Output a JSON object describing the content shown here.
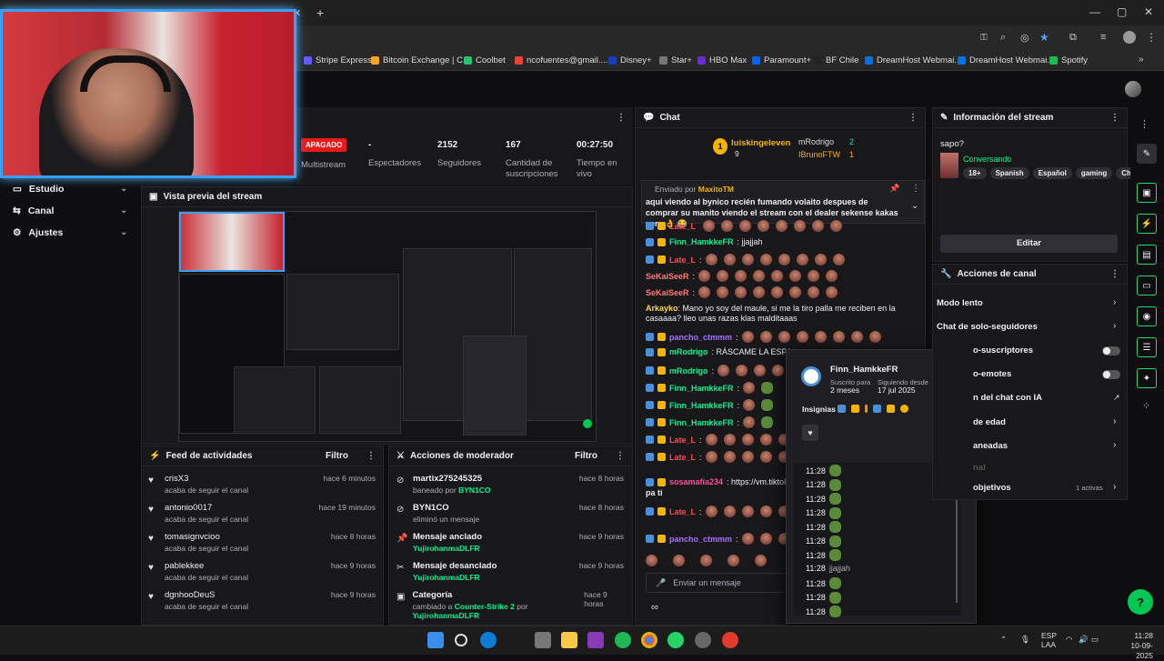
{
  "bookmarks": [
    {
      "label": "Stripe Express",
      "color": "#635bff"
    },
    {
      "label": "Bitcoin Exchange | C...",
      "color": "#f5a623"
    },
    {
      "label": "Coolbet",
      "color": "#27c26c"
    },
    {
      "label": "ncofuentes@gmail....",
      "color": "#ea4335"
    },
    {
      "label": "Disney+",
      "color": "#113ccf"
    },
    {
      "label": "Star+",
      "color": "#777"
    },
    {
      "label": "HBO Max",
      "color": "#6b2bd9"
    },
    {
      "label": "Paramount+",
      "color": "#0064ff"
    },
    {
      "label": "BF Chile",
      "color": "#222"
    },
    {
      "label": "DreamHost Webmai...",
      "color": "#0073ec"
    },
    {
      "label": "DreamHost Webmai...",
      "color": "#0073ec"
    },
    {
      "label": "Spotify",
      "color": "#1db954"
    }
  ],
  "nav": {
    "estudio": "Estudio",
    "canal": "Canal",
    "ajustes": "Ajustes"
  },
  "stats": {
    "status": "APAGADO",
    "multistream": "Multistream",
    "viewers_val": "-",
    "viewers_label": "Espectadores",
    "followers_val": "2152",
    "followers_label": "Seguidores",
    "subs_val": "167",
    "subs_label": "Cantidad de suscripciones",
    "time_val": "00:27:50",
    "time_label": "Tiempo en vivo"
  },
  "preview": {
    "title": "Vista previa del stream"
  },
  "feed": {
    "title": "Feed de actividades",
    "filter": "Filtro",
    "items": [
      {
        "user": "crisX3",
        "action": "acaba de seguir el canal",
        "time": "hace 6 minutos"
      },
      {
        "user": "antonio0017",
        "action": "acaba de seguir el canal",
        "time": "hace 19 minutos"
      },
      {
        "user": "tomasignvcioo",
        "action": "acaba de seguir el canal",
        "time": "hace 8 horas"
      },
      {
        "user": "pablekkee",
        "action": "acaba de seguir el canal",
        "time": "hace 9 horas"
      },
      {
        "user": "dgnhooDeuS",
        "action": "acaba de seguir el canal",
        "time": "hace 9 horas"
      }
    ]
  },
  "mod": {
    "title": "Acciones de moderador",
    "filter": "Filtro",
    "items": [
      {
        "title": "martix275245325",
        "pre": "baneado por ",
        "who": "BYN1CO",
        "mid": "",
        "who2": "",
        "time": "hace 8 horas"
      },
      {
        "title": "BYN1CO",
        "pre": "eliminó un mensaje",
        "who": "",
        "mid": "",
        "who2": "",
        "time": "hace 8 horas"
      },
      {
        "title": "Mensaje anclado",
        "pre": "",
        "who": "YujirohanmaDLFR",
        "mid": "",
        "who2": "",
        "time": "hace 9 horas"
      },
      {
        "title": "Mensaje desanclado",
        "pre": "",
        "who": "YujirohanmaDLFR",
        "mid": "",
        "who2": "",
        "time": "hace 9 horas"
      },
      {
        "title": "Categoría",
        "pre": "cambiado a ",
        "who": "Counter-Strike 2",
        "mid": " por ",
        "who2": "YujirohanmaDLFR",
        "time": "hace 9 horas"
      }
    ]
  },
  "chat": {
    "title": "Chat",
    "leader1": "luiskingeleven",
    "leader1_count": "9",
    "leader2": "mRodrigo",
    "leader2_count": "2",
    "leader3": "IBrunoFTW",
    "leader3_count": "1",
    "pinned_by": "Enviado por",
    "pinned_user": "MaxitoTM",
    "pinned_text": "aqui viendo al bynico recién fumando volaito despues de comprar su manito viendo el stream con el dealer sekense kakas yera 👌 😂",
    "lines": [
      {
        "user": "Late_L",
        "text": "",
        "color": "#ff4d4d"
      },
      {
        "user": "Finn_HamkkeFR",
        "text": ": jjajjah",
        "color": "#00f593"
      },
      {
        "user": "Late_L",
        "text": ":",
        "color": "#ff4d4d"
      },
      {
        "user": "SeKaiSeeR",
        "text": ":",
        "color": "#ff7a7a"
      },
      {
        "user": "SeKaiSeeR",
        "text": ":",
        "color": "#ff7a7a"
      },
      {
        "user": "Arkayko",
        "text": ": Mano yo soy del maule, si me la tiro palla me reciben en la casaaaa? lleo unas razas klas malditaaas",
        "color": "#ffd54f"
      },
      {
        "user": "pancho_ctmmm",
        "text": ":",
        "color": "#a970ff"
      },
      {
        "user": "mRodrigo",
        "text": ": RÁSCAME LA ESPA",
        "color": "#00f593"
      },
      {
        "user": "mRodrigo",
        "text": ":",
        "color": "#00f593"
      },
      {
        "user": "Finn_HamkkeFR",
        "text": ":",
        "color": "#00f593"
      },
      {
        "user": "Finn_HamkkeFR",
        "text": ":",
        "color": "#00f593"
      },
      {
        "user": "Finn_HamkkeFR",
        "text": ":",
        "color": "#00f593"
      },
      {
        "user": "Late_L",
        "text": ":",
        "color": "#ff4d4d"
      },
      {
        "user": "Late_L",
        "text": ":",
        "color": "#ff4d4d"
      },
      {
        "user": "sosamafia234",
        "text": ": https://vm.tiktok.com/",
        "color": "#ff4d9d"
      },
      {
        "user": "pa ti",
        "text": "",
        "color": "#efeff1"
      },
      {
        "user": "Late_L",
        "text": ":",
        "color": "#ff4d4d"
      },
      {
        "user": "pancho_ctmmm",
        "text": ":",
        "color": "#a970ff"
      }
    ],
    "input_placeholder": "Enviar un mensaje"
  },
  "usercard": {
    "name": "Finn_HamkkeFR",
    "sub_label": "Suscrito para",
    "sub_value": "2 meses",
    "follow_label": "Siguiendo desde",
    "follow_value": "17 jul 2025",
    "badges_label": "Insignias",
    "messages": [
      {
        "time": "11:28",
        "text": ""
      },
      {
        "time": "11:28",
        "text": ""
      },
      {
        "time": "11:28",
        "text": ""
      },
      {
        "time": "11:28",
        "text": ""
      },
      {
        "time": "11:28",
        "text": ""
      },
      {
        "time": "11:28",
        "text": ""
      },
      {
        "time": "11:28",
        "text": ""
      },
      {
        "time": "11:28",
        "text": "jjajjah"
      },
      {
        "time": "11:28",
        "text": ""
      },
      {
        "time": "11:28",
        "text": ""
      },
      {
        "time": "11:28",
        "text": ""
      }
    ]
  },
  "info": {
    "title": "Información del stream",
    "stream_title": "sapo?",
    "category": "Conversando",
    "tags": [
      "18+",
      "Spanish",
      "Español",
      "gaming",
      "Chile"
    ],
    "edit": "Editar"
  },
  "canal": {
    "title": "Acciones de canal",
    "items": [
      {
        "label": "Modo lento",
        "kind": "chev"
      },
      {
        "label": "Chat de solo-seguidores",
        "kind": "chev"
      },
      {
        "label": "o-suscriptores",
        "kind": "toggle"
      },
      {
        "label": "o-emotes",
        "kind": "toggle"
      },
      {
        "label": "n del chat con IA",
        "kind": "ext"
      },
      {
        "label": "de edad",
        "kind": "chev"
      },
      {
        "label": "aneadas",
        "kind": "chev"
      },
      {
        "label": "nal",
        "kind": "none"
      },
      {
        "label": "objetivos",
        "kind": "chev",
        "extra": "1 activas"
      }
    ]
  },
  "taskbar": {
    "lang": "ESP",
    "layout": "LAA",
    "time": "11:28",
    "date": "10-09-2025"
  }
}
